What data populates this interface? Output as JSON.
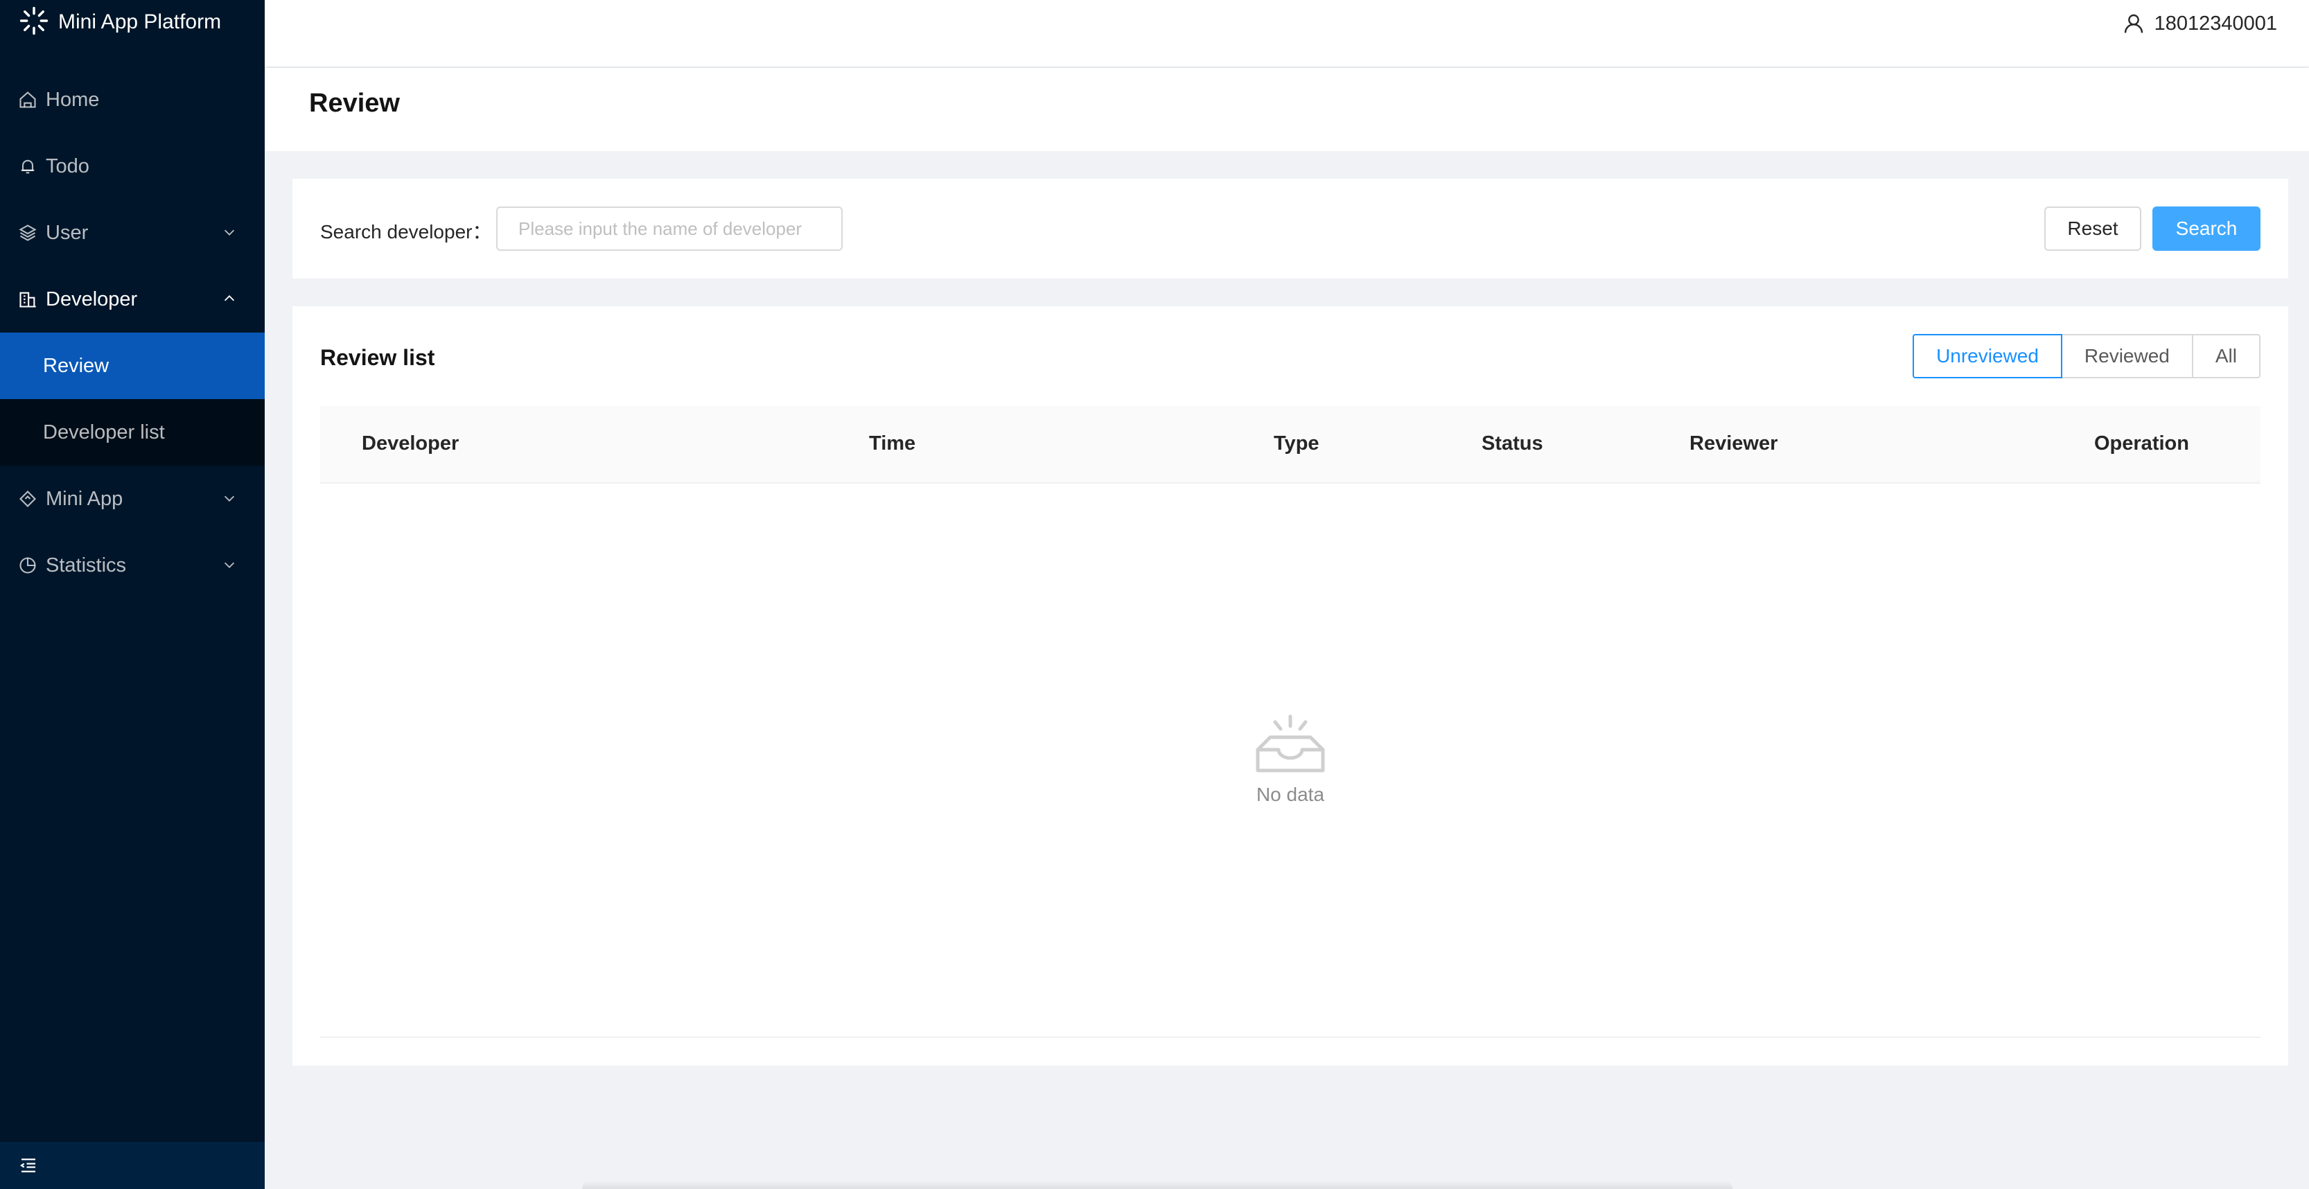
{
  "app": {
    "title": "Mini App Platform"
  },
  "header": {
    "username": "18012340001"
  },
  "sidebar": {
    "items": [
      {
        "label": "Home",
        "icon": "home-icon"
      },
      {
        "label": "Todo",
        "icon": "bell-icon"
      },
      {
        "label": "User",
        "icon": "layers-icon"
      },
      {
        "label": "Developer",
        "icon": "building-icon",
        "children": [
          {
            "label": "Review",
            "active": true
          },
          {
            "label": "Developer list"
          }
        ]
      },
      {
        "label": "Mini App",
        "icon": "diamond-icon"
      },
      {
        "label": "Statistics",
        "icon": "pie-chart-icon"
      }
    ]
  },
  "page": {
    "title": "Review"
  },
  "search": {
    "label": "Search developer：",
    "placeholder": "Please input the name of developer",
    "value": "",
    "reset_label": "Reset",
    "search_label": "Search"
  },
  "list": {
    "title": "Review list",
    "filters": [
      "Unreviewed",
      "Reviewed",
      "All"
    ],
    "active_filter": "Unreviewed",
    "columns": [
      "Developer",
      "Time",
      "Type",
      "Status",
      "Reviewer",
      "Operation"
    ],
    "empty_text": "No data"
  },
  "colors": {
    "sidebar_bg": "#001529",
    "active_menu": "#0958b7",
    "primary": "#1890ff",
    "search_button": "#40a9ff"
  }
}
